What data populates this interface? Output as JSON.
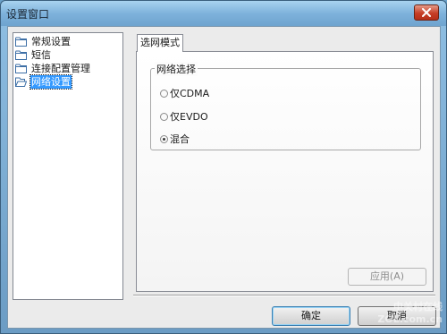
{
  "window": {
    "title": "设置窗口"
  },
  "tree": {
    "items": [
      {
        "label": "常规设置",
        "selected": false
      },
      {
        "label": "短信",
        "selected": false
      },
      {
        "label": "连接配置管理",
        "selected": false
      },
      {
        "label": "网络设置",
        "selected": true
      }
    ]
  },
  "tab": {
    "label": "选网模式"
  },
  "group": {
    "title": "网络选择",
    "options": [
      {
        "label": "仅CDMA",
        "checked": false
      },
      {
        "label": "仅EVDO",
        "checked": false
      },
      {
        "label": "混合",
        "checked": true
      }
    ]
  },
  "buttons": {
    "apply": "应用(A)",
    "ok": "确定",
    "cancel": "取消"
  },
  "watermark": {
    "line1": "中关村在线",
    "line2": "ZOL.com.cn"
  },
  "colors": {
    "titlebar": "#7eb2db",
    "selection": "#3399ff",
    "close": "#c63e26"
  },
  "icons": [
    "close-icon",
    "folder-icon",
    "folder-open-icon"
  ]
}
